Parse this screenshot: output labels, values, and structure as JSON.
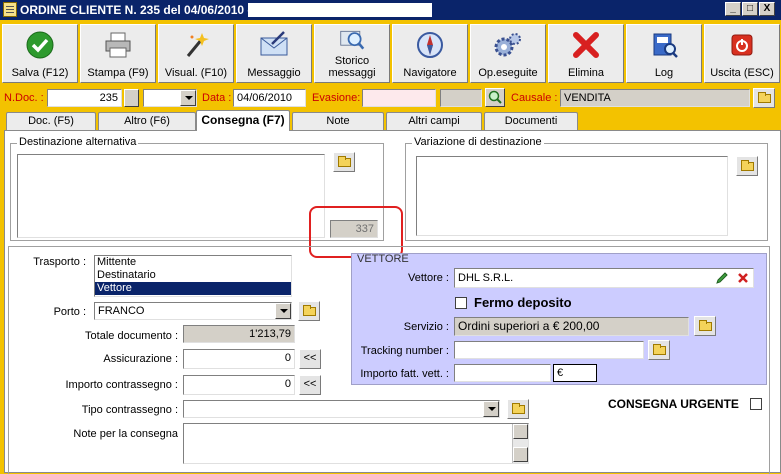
{
  "window": {
    "title": "ORDINE CLIENTE N. 235  del 04/06/2010 -",
    "controls": [
      "_",
      "□",
      "X"
    ]
  },
  "toolbar": [
    {
      "id": "salva",
      "label": "Salva (F12)",
      "icon": "check-icon"
    },
    {
      "id": "stampa",
      "label": "Stampa (F9)",
      "icon": "printer-icon"
    },
    {
      "id": "visual",
      "label": "Visual. (F10)",
      "icon": "magic-wand-icon"
    },
    {
      "id": "messaggio",
      "label": "Messaggio",
      "icon": "envelope-icon"
    },
    {
      "id": "storico",
      "label1": "Storico",
      "label2": "messaggi",
      "icon": "message-history-icon"
    },
    {
      "id": "navigatore",
      "label": "Navigatore",
      "icon": "compass-icon"
    },
    {
      "id": "opeseguite",
      "label": "Op.eseguite",
      "icon": "gears-icon"
    },
    {
      "id": "elimina",
      "label": "Elimina",
      "icon": "delete-x-icon"
    },
    {
      "id": "log",
      "label": "Log",
      "icon": "log-book-icon"
    },
    {
      "id": "uscita",
      "label": "Uscita (ESC)",
      "icon": "power-icon"
    }
  ],
  "header": {
    "ndoc_label": "N.Doc. :",
    "ndoc_value": "235",
    "data_label": "Data :",
    "data_value": "04/06/2010",
    "evasione_label": "Evasione:",
    "evasione_value": "",
    "causale_label": "Causale :",
    "causale_value": "VENDITA"
  },
  "tabs": [
    {
      "label": "Doc. (F5)",
      "active": false
    },
    {
      "label": "Altro (F6)",
      "active": false
    },
    {
      "label": "Consegna (F7)",
      "active": true
    },
    {
      "label": "Note",
      "active": false
    },
    {
      "label": "Altri campi",
      "active": false
    },
    {
      "label": "Documenti",
      "active": false
    }
  ],
  "consegna": {
    "dest_alt_title": "Destinazione alternativa",
    "dest_alt_value": "",
    "dest_code": "337",
    "variazione_title": "Variazione di destinazione",
    "variazione_value": "",
    "trasporto_label": "Trasporto :",
    "trasporto_options": [
      "Mittente",
      "Destinatario",
      "Vettore"
    ],
    "trasporto_selected": "Vettore",
    "porto_label": "Porto :",
    "porto_value": "FRANCO",
    "totale_label": "Totale documento :",
    "totale_value": "1'213,79",
    "assicurazione_label": "Assicurazione :",
    "assicurazione_value": "0",
    "contrassegno_label": "Importo contrassegno :",
    "contrassegno_value": "0",
    "tipo_contrassegno_label": "Tipo contrassegno :",
    "tipo_contrassegno_value": "",
    "note_label": "Note per la consegna",
    "note_value": "",
    "arrow_label": "<<",
    "urgente_label": "CONSEGNA URGENTE"
  },
  "vettore_box": {
    "title": "VETTORE",
    "vettore_label": "Vettore :",
    "vettore_value": "DHL S.R.L.",
    "fermo_label": "Fermo deposito",
    "servizio_label": "Servizio :",
    "servizio_value": "Ordini superiori a € 200,00",
    "tracking_label": "Tracking number :",
    "tracking_value": "",
    "importo_label": "Importo fatt. vett. :",
    "importo_value": "",
    "currency": "€"
  }
}
